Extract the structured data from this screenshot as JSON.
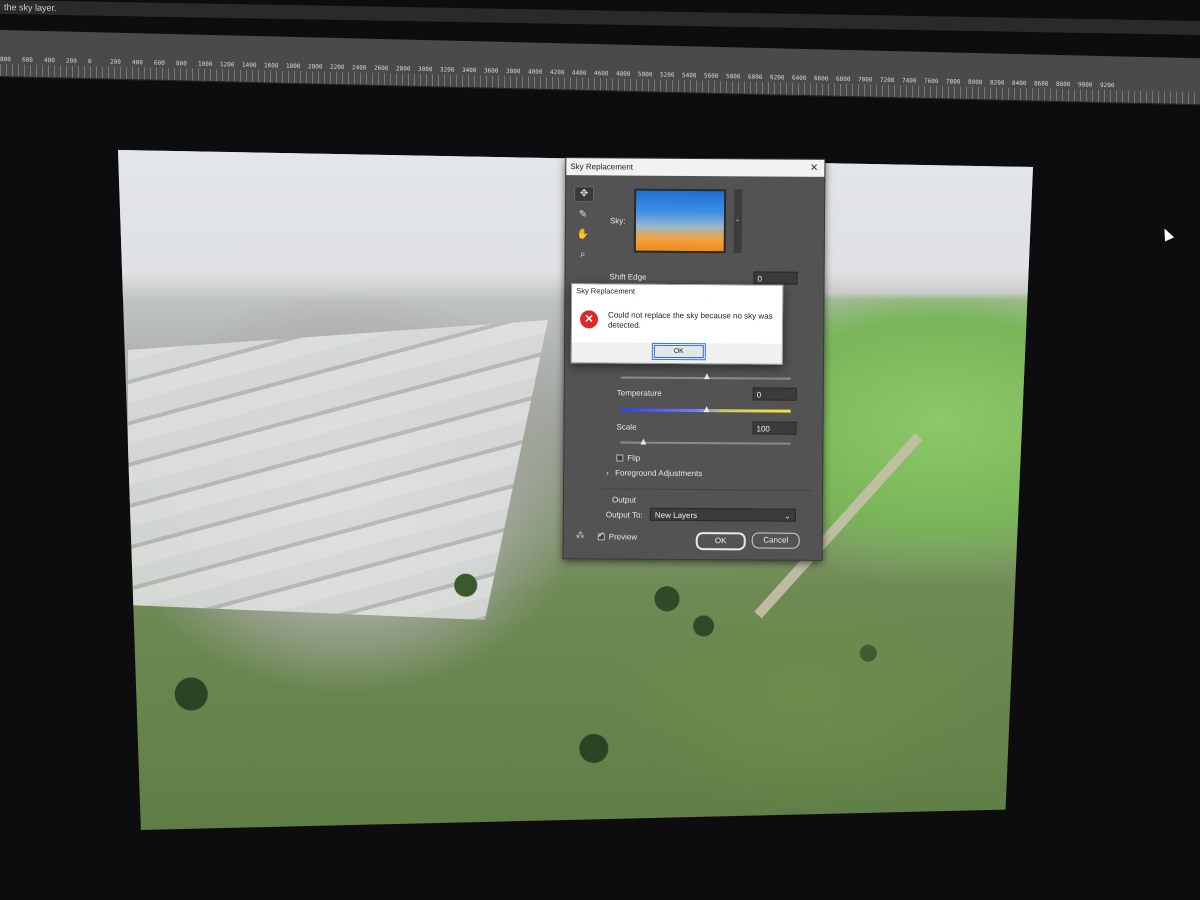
{
  "window": {
    "title_fragment": "the sky layer.",
    "ruler_labels": [
      "800",
      "600",
      "400",
      "200",
      "0",
      "200",
      "400",
      "600",
      "800",
      "1000",
      "1200",
      "1400",
      "1600",
      "1800",
      "2000",
      "2200",
      "2400",
      "2600",
      "2800",
      "3000",
      "3200",
      "3400",
      "3600",
      "3800",
      "4000",
      "4200",
      "4400",
      "4600",
      "4800",
      "5000",
      "5200",
      "5400",
      "5600",
      "5800",
      "6000",
      "6200",
      "6400",
      "6600",
      "6800",
      "7000",
      "7200",
      "7400",
      "7600",
      "7800",
      "8000",
      "8200",
      "8400",
      "8600",
      "8800",
      "9000",
      "9200"
    ]
  },
  "sky_panel": {
    "title": "Sky Replacement",
    "close_glyph": "✕",
    "tools": [
      {
        "name": "move-tool-icon",
        "glyph": "✥"
      },
      {
        "name": "brush-tool-icon",
        "glyph": "✎"
      },
      {
        "name": "hand-tool-icon",
        "glyph": "✋"
      },
      {
        "name": "zoom-tool-icon",
        "glyph": "⌕"
      }
    ],
    "sky_label": "Sky:",
    "sky_dropdown_glyph": "⌄",
    "shift_edge_label": "Shift Edge",
    "shift_edge_value": "0",
    "temperature_label": "Temperature",
    "temperature_value": "0",
    "scale_label": "Scale",
    "scale_value": "100",
    "flip_label": "Flip",
    "foreground_label": "Foreground Adjustments",
    "foreground_chevron": "›",
    "output_label": "Output",
    "output_to_label": "Output To:",
    "output_to_value": "New Layers",
    "output_chevron": "⌄",
    "preview_label": "Preview",
    "ok_label": "OK",
    "cancel_label": "Cancel",
    "colors": {
      "sky_top": "#1e6fd0",
      "sky_bottom": "#f08a1d"
    }
  },
  "alert": {
    "title": "Sky Replacement",
    "icon_glyph": "✕",
    "message": "Could not replace the sky because no sky was detected.",
    "ok_label": "OK",
    "colors": {
      "icon": "#e0252b"
    }
  }
}
